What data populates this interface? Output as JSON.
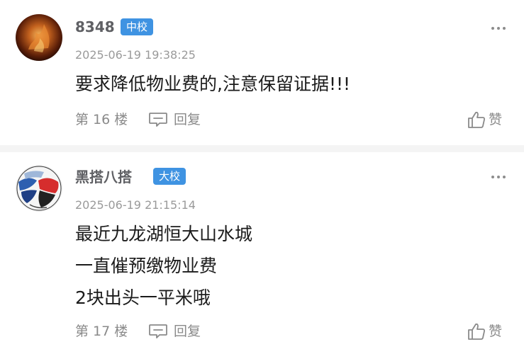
{
  "comments": [
    {
      "username": "8348",
      "badge": "中校",
      "timestamp": "2025-06-19 19:38:25",
      "content_lines": [
        "要求降低物业费的,注意保留证据!!!"
      ],
      "floor": "第 16 楼",
      "reply_label": "回复",
      "like_label": "赞",
      "avatar": "fire-avatar"
    },
    {
      "username": "黑搭八搭",
      "badge": "大校",
      "timestamp": "2025-06-19 21:15:14",
      "content_lines": [
        "最近九龙湖恒大山水城",
        "一直催预缴物业费",
        "2块出头一平米哦"
      ],
      "floor": "第 17 楼",
      "reply_label": "回复",
      "like_label": "赞",
      "avatar": "soccer-ball-avatar"
    }
  ],
  "icons": {
    "more": "more-dots-icon",
    "reply": "comment-bubble-icon",
    "like": "thumbs-up-icon"
  },
  "colors": {
    "badge": "#3f93e2",
    "username": "#5f6064",
    "timestamp": "#9a9a9a",
    "content": "#1b1b1b",
    "divider": "#f4f4f4"
  }
}
